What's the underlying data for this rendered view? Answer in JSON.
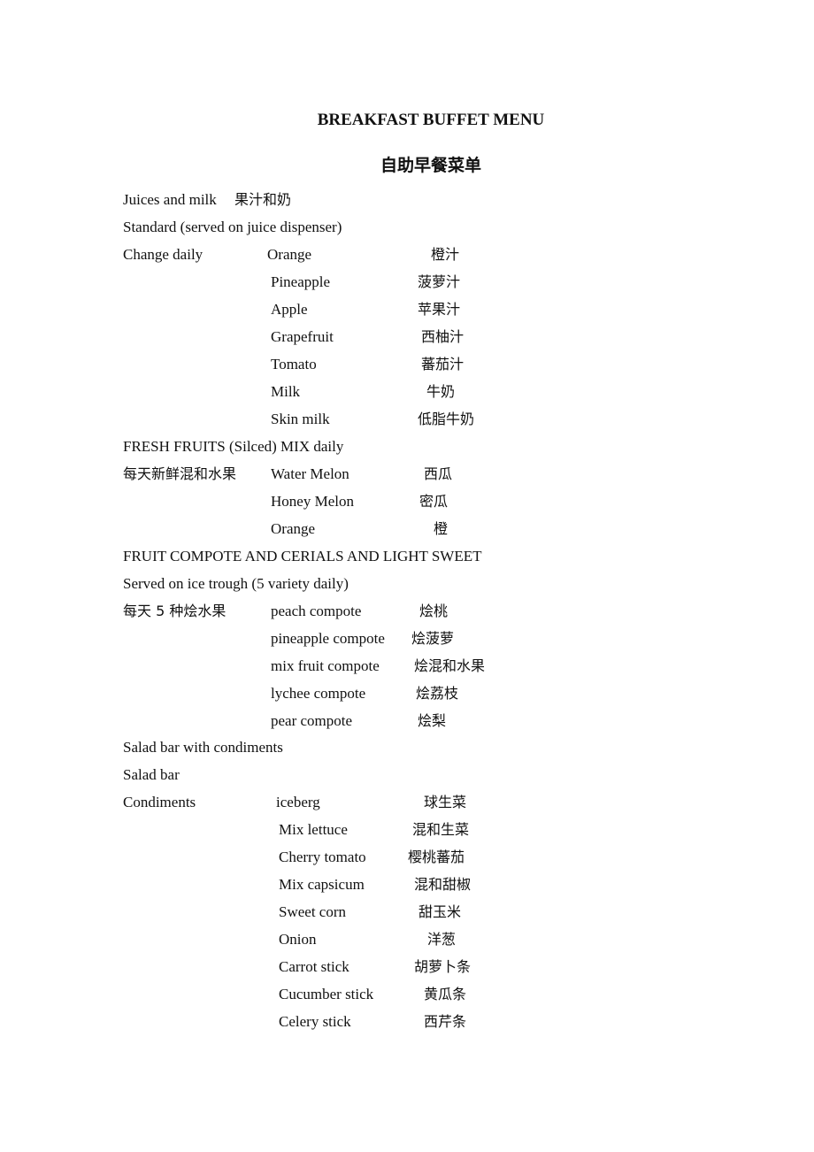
{
  "title": "BREAKFAST BUFFET MENU",
  "subtitle": "自助早餐菜单",
  "juices": {
    "heading": "Juices and milk",
    "heading_zh": "果汁和奶",
    "subheading": "Standard (served on juice dispenser)",
    "group_label": "Change daily",
    "items": [
      {
        "en": "Orange",
        "zh": "橙汁"
      },
      {
        "en": "Pineapple",
        "zh": "菠萝汁"
      },
      {
        "en": "Apple",
        "zh": "苹果汁"
      },
      {
        "en": "Grapefruit",
        "zh": "西柚汁"
      },
      {
        "en": "Tomato",
        "zh": "蕃茄汁"
      },
      {
        "en": "Milk",
        "zh": "牛奶"
      },
      {
        "en": "Skin milk",
        "zh": "低脂牛奶"
      }
    ]
  },
  "fresh_fruits": {
    "heading": "FRESH FRUITS (Silced) MIX daily",
    "group_label": "每天新鲜混和水果",
    "items": [
      {
        "en": "Water Melon",
        "zh": "西瓜"
      },
      {
        "en": "Honey Melon",
        "zh": "密瓜"
      },
      {
        "en": "Orange",
        "zh": "橙"
      }
    ]
  },
  "compote": {
    "heading": "FRUIT COMPOTE AND CERIALS AND LIGHT SWEET",
    "subheading": "Served on ice trough (5 variety daily)",
    "group_label": "每天 5 种烩水果",
    "items": [
      {
        "en": "peach compote",
        "zh": "烩桃"
      },
      {
        "en": "pineapple compote",
        "zh": "烩菠萝"
      },
      {
        "en": "mix fruit compote",
        "zh": "烩混和水果"
      },
      {
        "en": "lychee compote",
        "zh": "烩荔枝"
      },
      {
        "en": "pear compote",
        "zh": "烩梨"
      }
    ]
  },
  "salad": {
    "heading": "Salad bar with condiments",
    "subheading": "Salad bar",
    "group_label": "Condiments",
    "items": [
      {
        "en": "iceberg",
        "zh": "球生菜"
      },
      {
        "en": "Mix lettuce",
        "zh": "混和生菜"
      },
      {
        "en": "Cherry tomato",
        "zh": "樱桃蕃茄"
      },
      {
        "en": "Mix capsicum",
        "zh": "混和甜椒"
      },
      {
        "en": "Sweet corn",
        "zh": "甜玉米"
      },
      {
        "en": "Onion",
        "zh": "洋葱"
      },
      {
        "en": "Carrot stick",
        "zh": "胡萝卜条"
      },
      {
        "en": "Cucumber stick",
        "zh": "黄瓜条"
      },
      {
        "en": "Celery stick",
        "zh": "西芹条"
      }
    ]
  }
}
